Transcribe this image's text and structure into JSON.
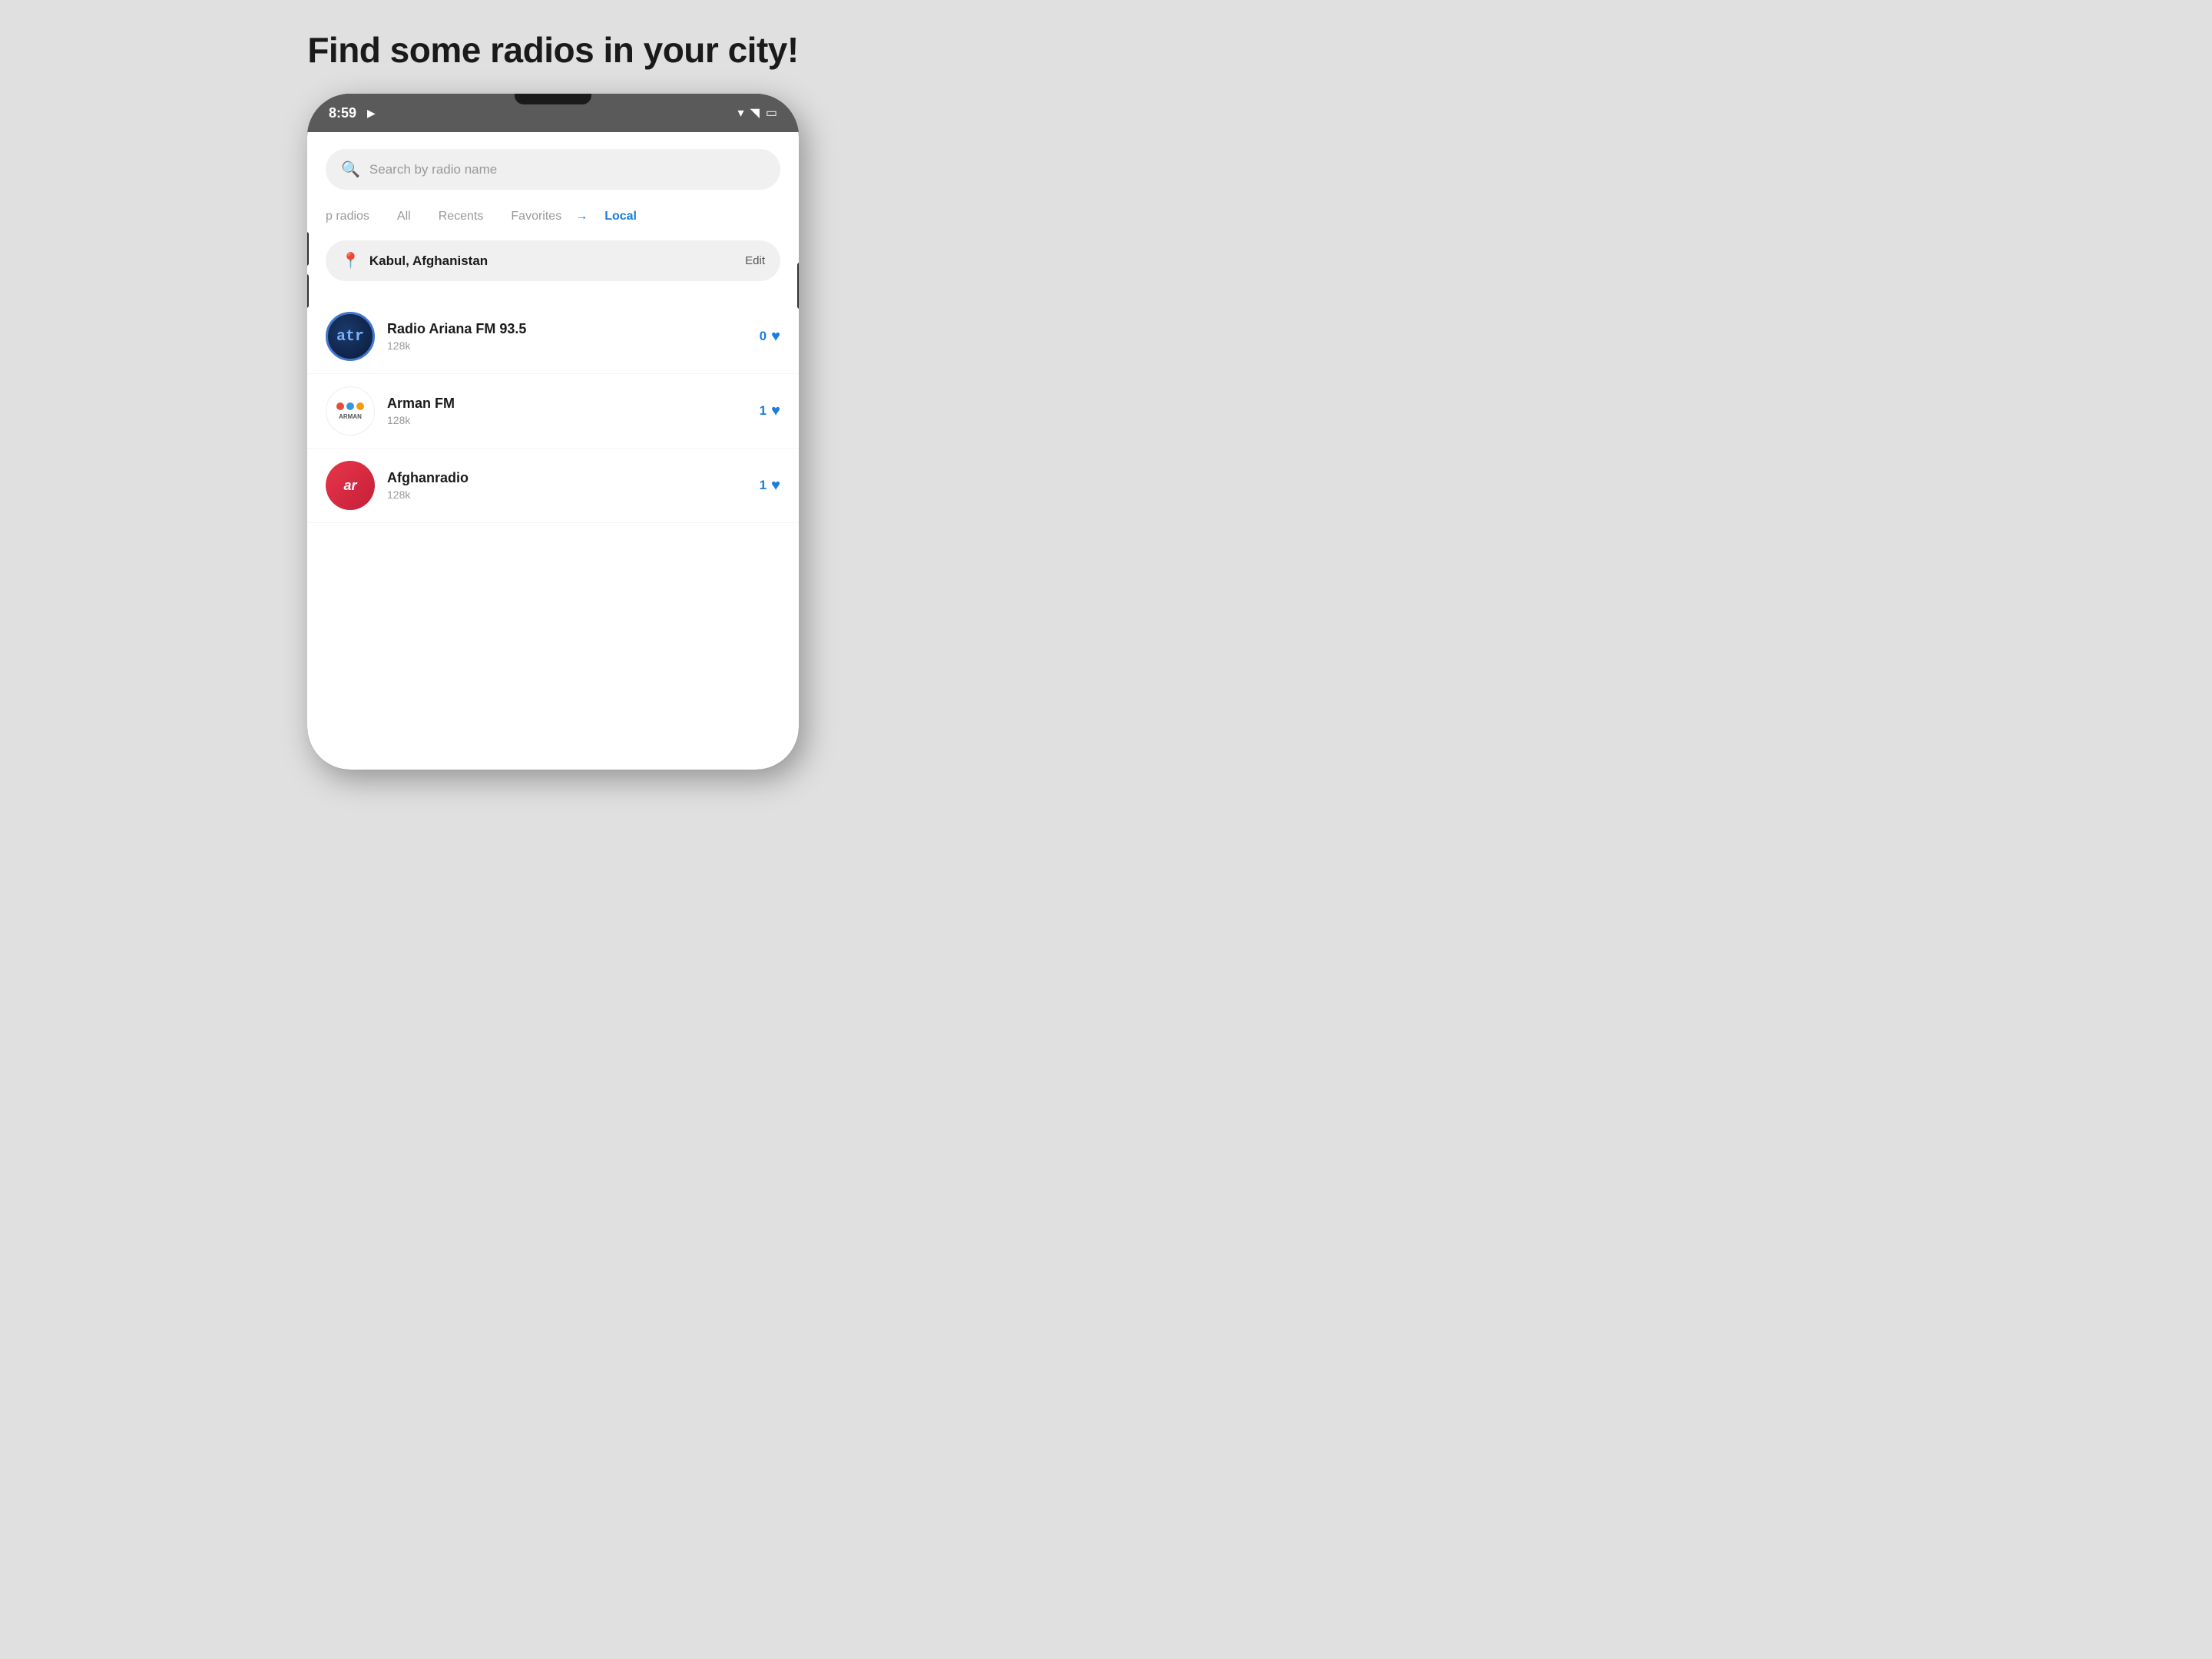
{
  "page": {
    "title": "Find some radios in your city!",
    "background_color": "#e0e0e0"
  },
  "status_bar": {
    "time": "8:59",
    "wifi": "▼",
    "signal": "▲",
    "battery": "▪"
  },
  "search": {
    "placeholder": "Search by radio name"
  },
  "tabs": [
    {
      "label": "p radios",
      "active": false,
      "partial": true
    },
    {
      "label": "All",
      "active": false
    },
    {
      "label": "Recents",
      "active": false
    },
    {
      "label": "Favorites",
      "active": false
    },
    {
      "label": "Local",
      "active": true
    }
  ],
  "location": {
    "name": "Kabul, Afghanistan",
    "edit_label": "Edit"
  },
  "radios": [
    {
      "name": "Radio Ariana FM 93.5",
      "bitrate": "128k",
      "favorites": "0",
      "logo_type": "atr"
    },
    {
      "name": "Arman FM",
      "bitrate": "128k",
      "favorites": "1",
      "logo_type": "arman"
    },
    {
      "name": "Afghanradio",
      "bitrate": "128k",
      "favorites": "1",
      "logo_type": "afghan"
    }
  ]
}
